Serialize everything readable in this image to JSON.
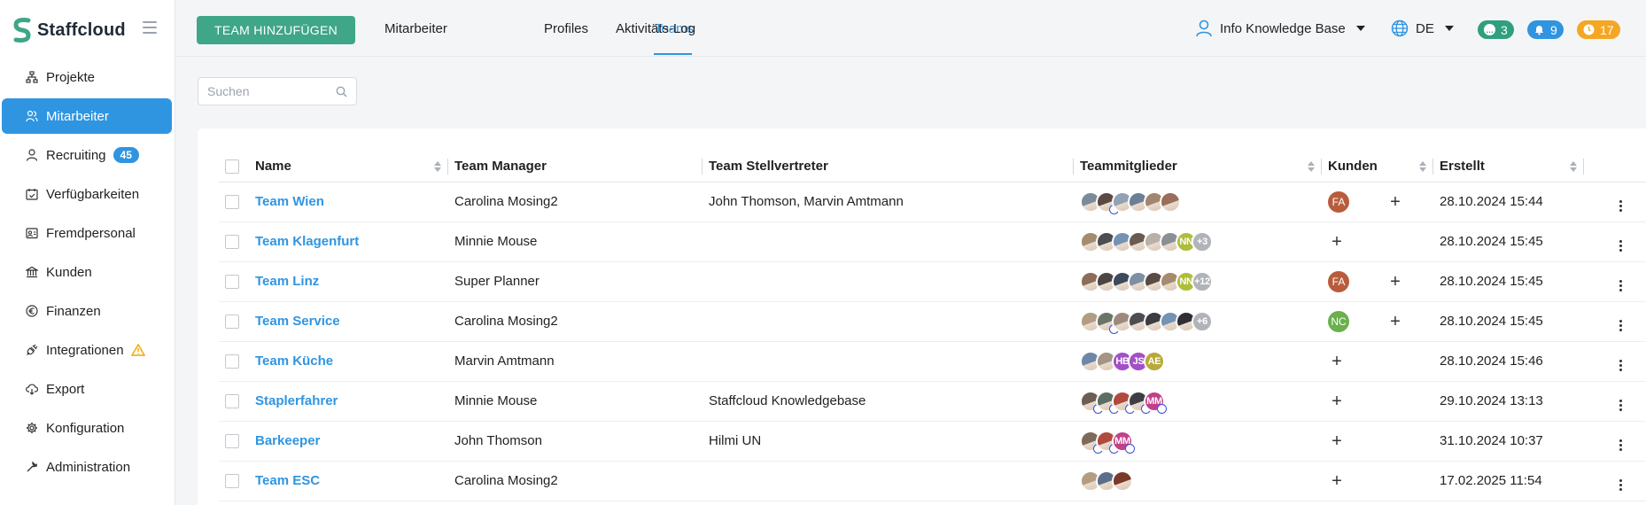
{
  "app": {
    "name": "Staffcloud"
  },
  "sidebar": {
    "items": [
      {
        "label": "Projekte",
        "icon": "sitemap-icon"
      },
      {
        "label": "Mitarbeiter",
        "icon": "users-icon",
        "active": true
      },
      {
        "label": "Recruiting",
        "icon": "person-icon",
        "badge": "45"
      },
      {
        "label": "Verfügbarkeiten",
        "icon": "calendar-check-icon"
      },
      {
        "label": "Fremdpersonal",
        "icon": "id-card-icon"
      },
      {
        "label": "Kunden",
        "icon": "bank-icon"
      },
      {
        "label": "Finanzen",
        "icon": "euro-icon"
      },
      {
        "label": "Integrationen",
        "icon": "plug-icon",
        "warning": true
      },
      {
        "label": "Export",
        "icon": "cloud-download-icon"
      },
      {
        "label": "Konfiguration",
        "icon": "gear-icon"
      },
      {
        "label": "Administration",
        "icon": "wrench-icon"
      }
    ]
  },
  "topbar": {
    "add_button": "TEAM HINZUFÜGEN",
    "tabs": [
      {
        "label": "Mitarbeiter"
      },
      {
        "label": "Teams",
        "active": true
      },
      {
        "label": "Profiles"
      },
      {
        "label": "Aktivitäts-Log"
      }
    ],
    "user": "Info Knowledge Base",
    "language": "DE",
    "counters": {
      "messages": "3",
      "notifications": "9",
      "timers": "17"
    }
  },
  "search": {
    "placeholder": "Suchen"
  },
  "table": {
    "headers": {
      "name": "Name",
      "manager": "Team Manager",
      "deputy": "Team Stellvertreter",
      "members": "Teammitglieder",
      "customers": "Kunden",
      "created": "Erstellt"
    },
    "rows": [
      {
        "name": "Team Wien",
        "manager": "Carolina Mosing2",
        "deputy": "John Thomson, Marvin Amtmann",
        "members": [
          {
            "c": "#7b8a99",
            "b": false
          },
          {
            "c": "#5b4a44",
            "b": true
          },
          {
            "c": "#8fa2b6",
            "b": false
          },
          {
            "c": "#6b7f95",
            "b": false
          },
          {
            "c": "#a38570",
            "b": false
          },
          {
            "c": "#9a6e5a",
            "b": false
          }
        ],
        "customer_initials": "FA",
        "customer_color": "#b85c3c",
        "created": "28.10.2024 15:44"
      },
      {
        "name": "Team Klagenfurt",
        "manager": "Minnie Mouse",
        "deputy": "",
        "members": [
          {
            "c": "#a58c6f"
          },
          {
            "c": "#4d4d52"
          },
          {
            "c": "#7591b3"
          },
          {
            "c": "#6a5a50"
          },
          {
            "c": "#b9b0a6"
          },
          {
            "c": "#8a8f96"
          },
          {
            "t": "NN",
            "c": "#aebd3a"
          },
          {
            "t": "+3",
            "c": "#b0b4b8"
          }
        ],
        "customer_initials": "",
        "customer_color": "",
        "created": "28.10.2024 15:45"
      },
      {
        "name": "Team Linz",
        "manager": "Super Planner",
        "deputy": "",
        "members": [
          {
            "c": "#8d6c5a"
          },
          {
            "c": "#4b4643"
          },
          {
            "c": "#3d4a5c"
          },
          {
            "c": "#7d8fa3"
          },
          {
            "c": "#5b4a44"
          },
          {
            "c": "#a58c6f"
          },
          {
            "t": "NN",
            "c": "#aebd3a"
          },
          {
            "t": "+12",
            "c": "#b0b4b8"
          }
        ],
        "customer_initials": "FA",
        "customer_color": "#b85c3c",
        "created": "28.10.2024 15:45"
      },
      {
        "name": "Team Service",
        "manager": "Carolina Mosing2",
        "deputy": "",
        "members": [
          {
            "c": "#b39d82"
          },
          {
            "c": "#6a7568",
            "b": true
          },
          {
            "c": "#9c8b7d"
          },
          {
            "c": "#4d4d52"
          },
          {
            "c": "#3c3c42"
          },
          {
            "c": "#7591b3"
          },
          {
            "c": "#2f2f35"
          },
          {
            "t": "+6",
            "c": "#b0b4b8"
          }
        ],
        "customer_initials": "NC",
        "customer_color": "#6ab04c",
        "created": "28.10.2024 15:45"
      },
      {
        "name": "Team Küche",
        "manager": "Marvin Amtmann",
        "deputy": "",
        "members": [
          {
            "c": "#6c87a8"
          },
          {
            "c": "#a39486"
          },
          {
            "t": "HB",
            "c": "#a34fc7"
          },
          {
            "t": "JS",
            "c": "#a34fc7"
          },
          {
            "t": "AE",
            "c": "#b8a93a"
          }
        ],
        "customer_initials": "",
        "customer_color": "",
        "created": "28.10.2024 15:46"
      },
      {
        "name": "Staplerfahrer",
        "manager": "Minnie Mouse",
        "deputy": "Staffcloud Knowledgebase",
        "members": [
          {
            "c": "#6d5d52",
            "b": true
          },
          {
            "c": "#5c6e63",
            "b": true
          },
          {
            "c": "#b04a3c",
            "b": true
          },
          {
            "c": "#3e3e44",
            "b": true
          },
          {
            "t": "MM",
            "c": "#c2408a",
            "b": true
          }
        ],
        "customer_initials": "",
        "customer_color": "",
        "created": "29.10.2024 13:13"
      },
      {
        "name": "Barkeeper",
        "manager": "John Thomson",
        "deputy": "Hilmi UN",
        "members": [
          {
            "c": "#7c6a5c",
            "b": true
          },
          {
            "c": "#b04a3c",
            "b": true
          },
          {
            "t": "MM",
            "c": "#c2408a",
            "b": true
          }
        ],
        "customer_initials": "",
        "customer_color": "",
        "created": "31.10.2024 10:37"
      },
      {
        "name": "Team ESC",
        "manager": "Carolina Mosing2",
        "deputy": "",
        "members": [
          {
            "c": "#b39d82"
          },
          {
            "c": "#5b6f8a"
          },
          {
            "c": "#7a3a2a"
          }
        ],
        "customer_initials": "",
        "customer_color": "",
        "created": "17.02.2025 11:54"
      }
    ]
  }
}
